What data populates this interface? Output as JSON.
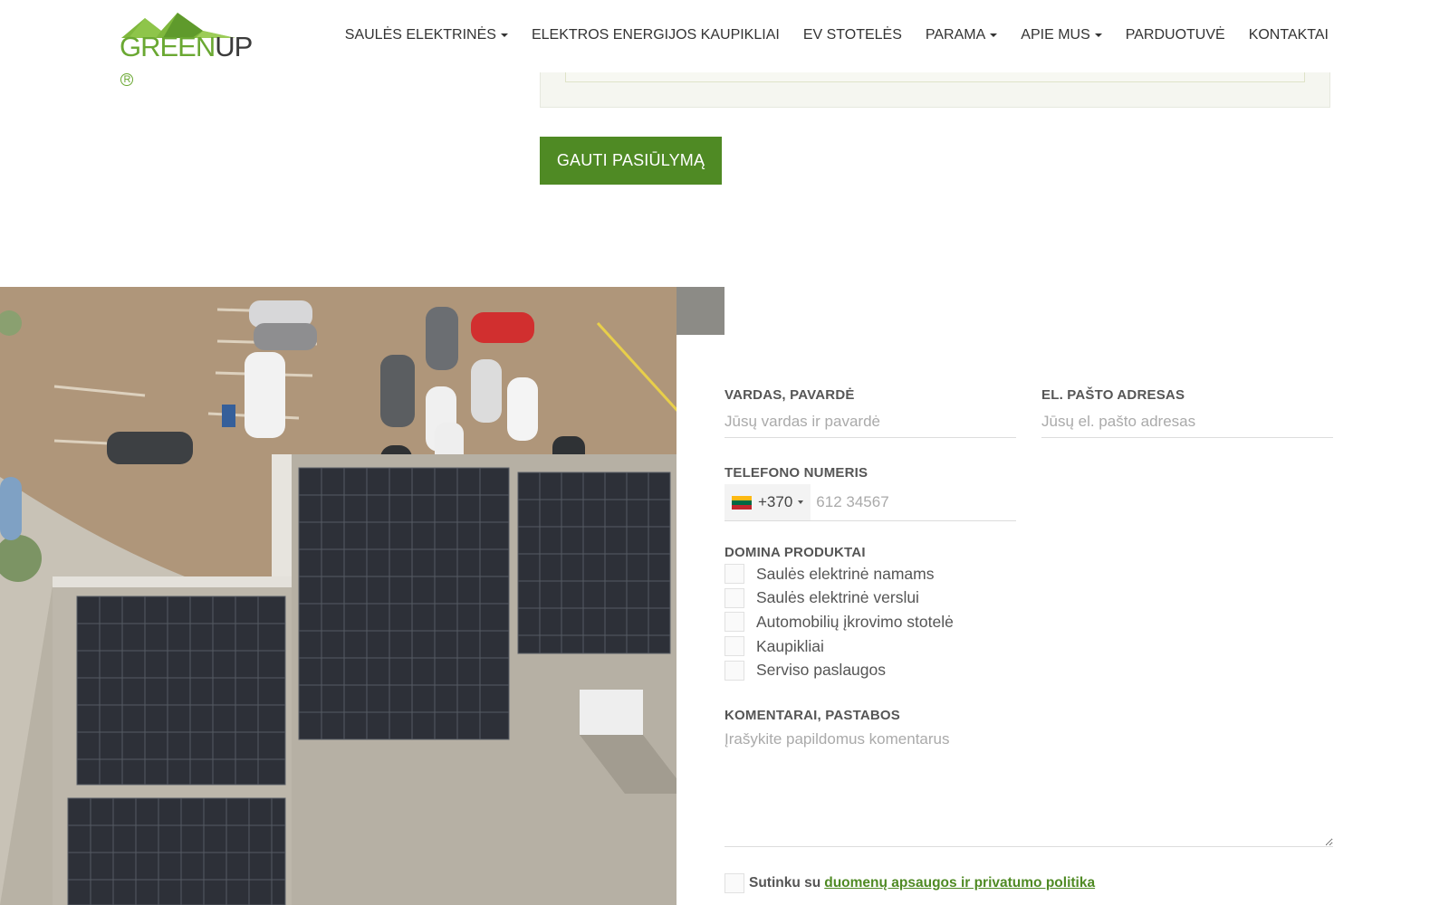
{
  "logo": {
    "part1": "GREEN",
    "part2": "UP",
    "reg": "R",
    "colors": {
      "green": "#6aa832",
      "dark": "#3b3b3b"
    }
  },
  "nav": {
    "items": [
      {
        "label": "SAULĖS ELEKTRINĖS",
        "dropdown": true
      },
      {
        "label": "ELEKTROS ENERGIJOS KAUPIKLIAI",
        "dropdown": false
      },
      {
        "label": "EV STOTELĖS",
        "dropdown": false
      },
      {
        "label": "PARAMA",
        "dropdown": true
      },
      {
        "label": "APIE MUS",
        "dropdown": true
      },
      {
        "label": "PARDUOTUVĖ",
        "dropdown": false
      },
      {
        "label": "KONTAKTAI",
        "dropdown": false
      }
    ]
  },
  "offer_button": {
    "label": "GAUTI PASIŪLYMĄ",
    "color": "#4f8a24"
  },
  "form": {
    "name": {
      "label": "VARDAS, PAVARDĖ",
      "placeholder": "Jūsų vardas ir pavardė"
    },
    "email": {
      "label": "EL. PAŠTO ADRESAS",
      "placeholder": "Jūsų el. pašto adresas"
    },
    "phone": {
      "label": "TELEFONO NUMERIS",
      "dial_code": "+370",
      "placeholder": "612 34567",
      "flag_icon": "lithuania-flag-icon"
    },
    "products": {
      "label": "DOMINA PRODUKTAI",
      "options": [
        "Saulės elektrinė namams",
        "Saulės elektrinė verslui",
        "Automobilių įkrovimo stotelė",
        "Kaupikliai",
        "Serviso paslaugos"
      ]
    },
    "comments": {
      "label": "KOMENTARAI, PASTABOS",
      "placeholder": "Įrašykite papildomus komentarus"
    },
    "consent": {
      "text": "Sutinku su",
      "link": "duomenų apsaugos ir privatumo politika"
    }
  }
}
